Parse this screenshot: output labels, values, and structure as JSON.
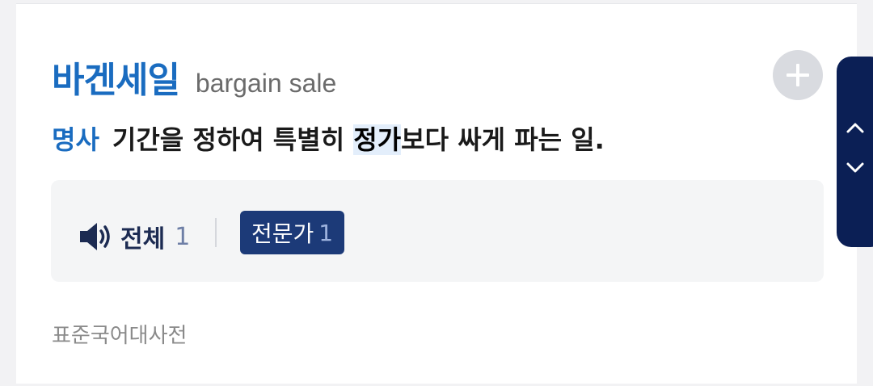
{
  "entry": {
    "headword": "바겐세일",
    "origin": "bargain sale",
    "pos": "명사",
    "definition_before": "기간을 정하여 특별히 ",
    "definition_highlight": "정가",
    "definition_after": "보다 싸게 파는 일."
  },
  "audio": {
    "all_label": "전체",
    "all_count": "1",
    "expert_label": "전문가",
    "expert_count": "1"
  },
  "source": "표준국어대사전",
  "icons": {
    "add": "plus-icon",
    "speaker": "speaker-icon",
    "up": "chevron-up-icon",
    "down": "chevron-down-icon"
  },
  "colors": {
    "headword": "#1a6cc0",
    "badge_bg": "#1c3a78",
    "nav_bg": "#0b1f55"
  }
}
